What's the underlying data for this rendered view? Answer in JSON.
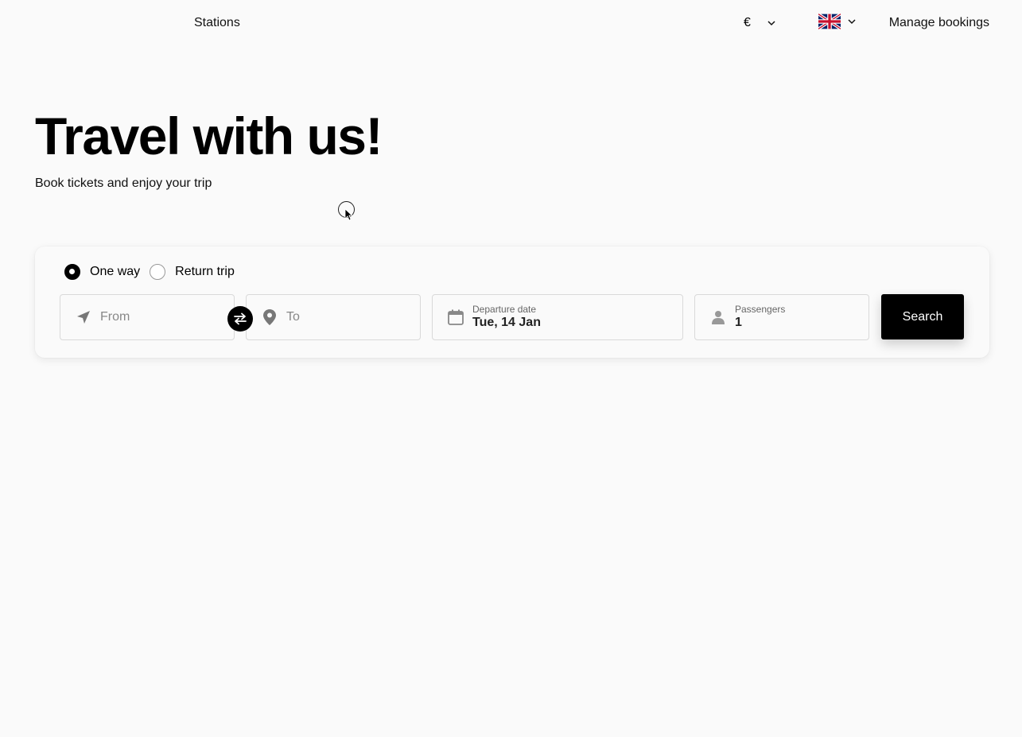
{
  "header": {
    "stations_label": "Stations",
    "currency_symbol": "€",
    "language": "English (UK)",
    "manage_label": "Manage bookings"
  },
  "hero": {
    "title": "Travel with us!",
    "subtitle": "Book tickets and enjoy your trip"
  },
  "search": {
    "trip_types": [
      {
        "label": "One way",
        "selected": true
      },
      {
        "label": "Return trip",
        "selected": false
      }
    ],
    "from_placeholder": "From",
    "to_placeholder": "To",
    "date_label": "Departure date",
    "date_value": "Tue, 14 Jan",
    "passengers_label": "Passengers",
    "passengers_value": "1",
    "search_label": "Search"
  },
  "icons": {
    "from": "navigation-arrow-icon",
    "to": "map-pin-icon",
    "date": "calendar-icon",
    "passengers": "person-icon",
    "swap": "swap-arrows-icon",
    "dropdown": "chevron-down-icon",
    "flag": "uk-flag-icon"
  }
}
